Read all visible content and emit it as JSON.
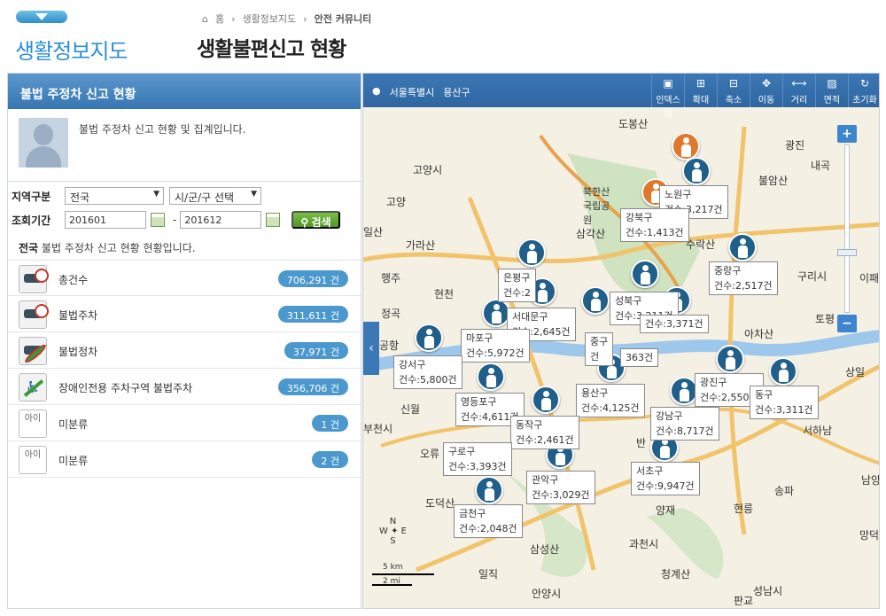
{
  "header": {
    "site_title": "생활정보지도",
    "breadcrumb": [
      "홈",
      "생활정보지도",
      "안전 커뮤니티"
    ],
    "page_title": "생활불편신고 현황"
  },
  "panel": {
    "title": "불법 주정차 신고 현황",
    "intro": "불법 주정차 신고 현황 및 집계입니다.",
    "region_label": "지역구분",
    "region_value": "전국",
    "district_value": "시/군/구 선택",
    "period_label": "조회기간",
    "date_from": "201601",
    "date_sep": "-",
    "date_to": "201612",
    "search_label": "검색",
    "summary_region": "전국",
    "summary_text": "불법 주정차 신고 현황 현황입니다.",
    "items": [
      {
        "name": "총건수",
        "count": "706,291 건",
        "icon": "car-icon"
      },
      {
        "name": "불법주차",
        "count": "311,611 건",
        "icon": "car-icon"
      },
      {
        "name": "불법정차",
        "count": "37,971 건",
        "icon": "no-stop-icon"
      },
      {
        "name": "장애인전용 주차구역 불법주차",
        "count": "356,706 건",
        "icon": "disabled-parking-icon"
      },
      {
        "name": "미분류",
        "count": "1 건",
        "icon": "broken-image-icon",
        "alt": "아이"
      },
      {
        "name": "미분류",
        "count": "2 건",
        "icon": "broken-image-icon",
        "alt": "아이"
      }
    ]
  },
  "map": {
    "location": [
      "서울특별시",
      "용산구"
    ],
    "tools": [
      {
        "label": "인덱스맵",
        "icon": "index-map-icon"
      },
      {
        "label": "확대",
        "icon": "zoom-in-icon"
      },
      {
        "label": "축소",
        "icon": "zoom-out-icon"
      },
      {
        "label": "이동",
        "icon": "move-icon"
      },
      {
        "label": "거리",
        "icon": "distance-icon"
      },
      {
        "label": "면적",
        "icon": "area-icon"
      },
      {
        "label": "초기화",
        "icon": "reset-icon"
      }
    ],
    "districts": [
      {
        "name": "노원구",
        "count": "건수:3,217건"
      },
      {
        "name": "강북구",
        "count": "건수:1,413건"
      },
      {
        "name": "은평구",
        "count": "건수:2"
      },
      {
        "name": "중랑구",
        "count": "건수:2,517건"
      },
      {
        "name": "서대문구",
        "count": "건수:2,645건"
      },
      {
        "name": "성북구",
        "count": "건수:3,211건"
      },
      {
        "name": "마포구",
        "count": "건수:5,972건"
      },
      {
        "name": "중구",
        "count": "건"
      },
      {
        "name": "",
        "count": "363건"
      },
      {
        "name": "",
        "count": "건수:3,371건"
      },
      {
        "name": "강서구",
        "count": "건수:5,800건"
      },
      {
        "name": "광진구",
        "count": "건수:2,550건"
      },
      {
        "name": "동구",
        "count": "건수:3,311건"
      },
      {
        "name": "용산구",
        "count": "건수:4,125건"
      },
      {
        "name": "영등포구",
        "count": "건수:4,611건"
      },
      {
        "name": "동작구",
        "count": "건수:2,461건"
      },
      {
        "name": "강남구",
        "count": "건수:8,717건"
      },
      {
        "name": "구로구",
        "count": "건수:3,393건"
      },
      {
        "name": "관악구",
        "count": "건수:3,029건"
      },
      {
        "name": "서초구",
        "count": "건수:9,947건"
      },
      {
        "name": "금천구",
        "count": "건수:2,048건"
      }
    ],
    "places": [
      "도봉산",
      "고양시",
      "북한산 국립공원",
      "삼각산",
      "가라산",
      "현천",
      "행주",
      "정곡",
      "공항",
      "신월",
      "부천시",
      "오류",
      "도덕산",
      "일직",
      "삼성산",
      "과천시",
      "청계산",
      "안양시",
      "구리시",
      "남양주",
      "광진",
      "내곡",
      "불암산",
      "아차산",
      "상일",
      "서하남",
      "성남시",
      "송파",
      "현릉",
      "판교",
      "망덕",
      "이패",
      "토평",
      "양재",
      "수락산",
      "일산",
      "고양",
      "반"
    ],
    "scale_km": "5 km",
    "scale_mi": "2 mi",
    "compass": [
      "N",
      "W",
      "E",
      "S"
    ]
  }
}
